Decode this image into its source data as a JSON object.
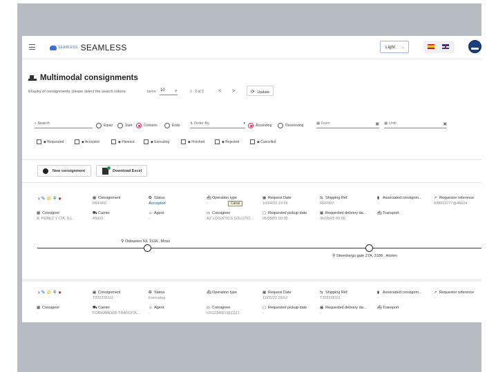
{
  "app": {
    "brand_small": "SEAMLESS",
    "brand_big": "SEAMLESS",
    "theme_value": "Light"
  },
  "header": {
    "title": "Multimodal consignments",
    "subtitle": "Enquiry of consignments, please select the search criteria",
    "items_label": "Items:",
    "items_value": "10",
    "range": "1 - 2 of 2",
    "prev": "<",
    "next": ">",
    "update_label": "Update"
  },
  "filters": {
    "search_placeholder": "Search",
    "match_options": [
      {
        "label": "Equal",
        "selected": false
      },
      {
        "label": "Start",
        "selected": false
      },
      {
        "label": "Contains",
        "selected": true
      },
      {
        "label": "Ends",
        "selected": false
      }
    ],
    "order_by_placeholder": "Order By",
    "sort_options": [
      {
        "label": "Ascending",
        "selected": true
      },
      {
        "label": "Descending",
        "selected": false
      }
    ],
    "from_placeholder": "From",
    "until_placeholder": "Until",
    "status_checkboxes": [
      "Requested",
      "Accepted",
      "Planned",
      "Executing",
      "Finished",
      "Rejected",
      "Cancelled"
    ]
  },
  "actions": {
    "new_label": "New consignment",
    "excel_label": "Download Excel"
  },
  "records": [
    {
      "consignment_label": "Consignment",
      "consignment": "REF002",
      "status_label": "Status",
      "status": "Accepted",
      "operation_label": "Operation type",
      "operation": "-",
      "operation_tag": "Canal",
      "request_date_label": "Request Date",
      "request_date": "10/04/25 10:56",
      "shipping_ref_label": "Shipping Ref.",
      "shipping_ref": "REF002",
      "associated_label": "Associated consignm...",
      "associated": "-",
      "requestor_label": "Requestor reference",
      "requestor": "839003777@46024",
      "consignor_label": "Consignor",
      "consignor": "A. PÉREZ Y CÍA, S.L.",
      "carrier_label": "Carrier",
      "carrier": "ASKO",
      "agent_label": "Agent",
      "agent": "-",
      "consignee_label": "Consignee",
      "consignee": "AZ LOGISTICS SOLUTIO...",
      "pickup_label": "Requested pickup date",
      "pickup": "05/05/25 00:00",
      "delivery_label": "Requested delivery da...",
      "delivery": "06/05/25 00:00",
      "transport_label": "Transport",
      "transport": "",
      "origin": "Osloveien 53, 1534 , Moss",
      "destination": "Steenbergs gate 27A, 3188 , Horten"
    },
    {
      "consignment_label": "Consignment",
      "consignment": "T202206111",
      "status_label": "Status",
      "status": "Executing",
      "operation_label": "Operation type",
      "operation": "",
      "request_date_label": "Request Date",
      "request_date": "11/06/22 09:52",
      "shipping_ref_label": "Shipping Ref.",
      "shipping_ref": "T202206111",
      "associated_label": "Associated consignm...",
      "associated": "-",
      "requestor_label": "Requestor reference",
      "requestor": "-",
      "consignor_label": "Consignor",
      "consignor": "-",
      "carrier_label": "Carrier",
      "carrier": "FORWARDER TRANSITA...",
      "agent_label": "Agent",
      "agent": "-",
      "consignee_label": "Consignee",
      "consignee": "US1234567@ZZZ1",
      "pickup_label": "Requested pickup date",
      "pickup": "-",
      "delivery_label": "Requested delivery da...",
      "delivery": "-",
      "transport_label": "Transport",
      "transport": ""
    }
  ],
  "colors": {
    "frame": "#b7bcc2",
    "accent_pink": "#e0245e",
    "status_accepted": "#3b82c4",
    "icon_green": "#1e9e4a",
    "icon_red": "#d93025",
    "icon_blue": "#1a73e8",
    "icon_orange": "#f0a500"
  },
  "icons": [
    "chevron-right-icon",
    "pencil-icon",
    "ban-icon",
    "hierarchy-icon",
    "map-pin-icon"
  ]
}
